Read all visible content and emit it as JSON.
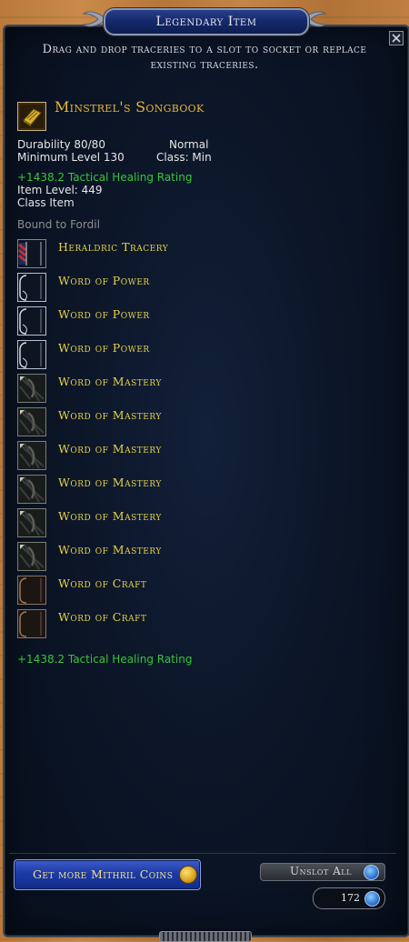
{
  "window": {
    "title": "Legendary Item",
    "close_icon": "close-icon"
  },
  "instructions": "Drag and drop traceries to a slot to socket or replace existing traceries.",
  "item": {
    "name": "Minstrel's Songbook",
    "icon": "songbook-icon",
    "durability": "Durability 80/80",
    "quality": "Normal",
    "min_level": "Minimum Level 130",
    "class_req": "Class: Min",
    "bonus_top": "+1438.2 Tactical Healing Rating",
    "item_level": "Item Level: 449",
    "class_item": "Class Item",
    "bound": "Bound to Fordil",
    "bonus_bottom": "+1438.2 Tactical Healing Rating"
  },
  "traceries": [
    {
      "label": "Heraldric Tracery",
      "icon": "heraldric-tracery-icon",
      "kind": "heraldric"
    },
    {
      "label": "Word of Power",
      "icon": "word-of-power-icon",
      "kind": "power"
    },
    {
      "label": "Word of Power",
      "icon": "word-of-power-icon",
      "kind": "power"
    },
    {
      "label": "Word of Power",
      "icon": "word-of-power-icon",
      "kind": "power"
    },
    {
      "label": "Word of Mastery",
      "icon": "word-of-mastery-icon",
      "kind": "mastery"
    },
    {
      "label": "Word of Mastery",
      "icon": "word-of-mastery-icon",
      "kind": "mastery"
    },
    {
      "label": "Word of Mastery",
      "icon": "word-of-mastery-icon",
      "kind": "mastery"
    },
    {
      "label": "Word of Mastery",
      "icon": "word-of-mastery-icon",
      "kind": "mastery"
    },
    {
      "label": "Word of Mastery",
      "icon": "word-of-mastery-icon",
      "kind": "mastery"
    },
    {
      "label": "Word of Mastery",
      "icon": "word-of-mastery-icon",
      "kind": "mastery"
    },
    {
      "label": "Word of Craft",
      "icon": "word-of-craft-icon",
      "kind": "craft"
    },
    {
      "label": "Word of Craft",
      "icon": "word-of-craft-icon",
      "kind": "craft"
    }
  ],
  "footer": {
    "mithril_button": "Get more Mithril Coins",
    "unslot_button": "Unslot All",
    "currency_count": "172"
  },
  "colors": {
    "title_gold": "#e7b53a",
    "tracery_yellow": "#e3d24a",
    "bonus_green": "#39c43c",
    "panel_navy": "#0c1628"
  }
}
